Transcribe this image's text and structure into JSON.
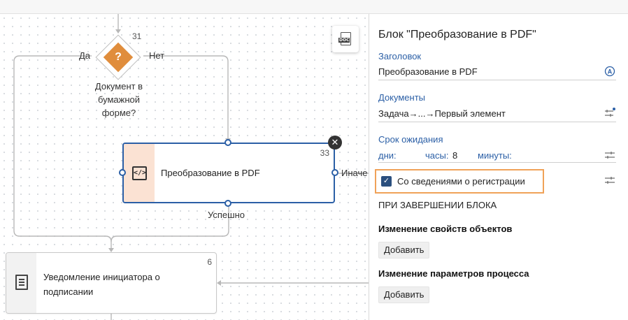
{
  "canvas": {
    "decision": {
      "number": "31",
      "yes_label": "Да",
      "no_label": "Нет",
      "caption": [
        "Документ в",
        "бумажной",
        "форме?"
      ],
      "color": "#e08d3c",
      "icon": "question-icon",
      "glyph": "?"
    },
    "pdf_block": {
      "number": "33",
      "label": "Преобразование в PDF",
      "success_label": "Успешно",
      "else_label": "Иначе",
      "icon": "code-icon",
      "icon_glyph": "</>",
      "border_color": "#2b5fa6",
      "close_glyph": "✕"
    },
    "notify_block": {
      "number": "6",
      "label": "Уведомление инициатора о подписании",
      "icon": "document-lines-icon"
    },
    "floating_button": {
      "icon": "document-convert-icon",
      "tag": "DOC"
    }
  },
  "panel": {
    "title": "Блок \"Преобразование в PDF\"",
    "header_field": {
      "label": "Заголовок",
      "value": "Преобразование в PDF",
      "icon": "auto-title-icon"
    },
    "documents_field": {
      "label": "Документы",
      "value": "Задача→...→Первый элемент",
      "icon": "settings-sliders-icon"
    },
    "wait_field": {
      "label": "Срок ожидания",
      "days_label": "дни:",
      "hours_label": "часы:",
      "hours_value": "8",
      "minutes_label": "минуты:",
      "icon": "settings-sliders-icon"
    },
    "registration": {
      "label": "Со сведениями о регистрации",
      "checked": true,
      "highlight_color": "#f0a258",
      "icon": "settings-sliders-icon"
    },
    "on_complete_heading": "ПРИ ЗАВЕРШЕНИИ БЛОКА",
    "object_props": {
      "heading": "Изменение свойств объектов",
      "button": "Добавить"
    },
    "process_params": {
      "heading": "Изменение параметров процесса",
      "button": "Добавить"
    }
  }
}
